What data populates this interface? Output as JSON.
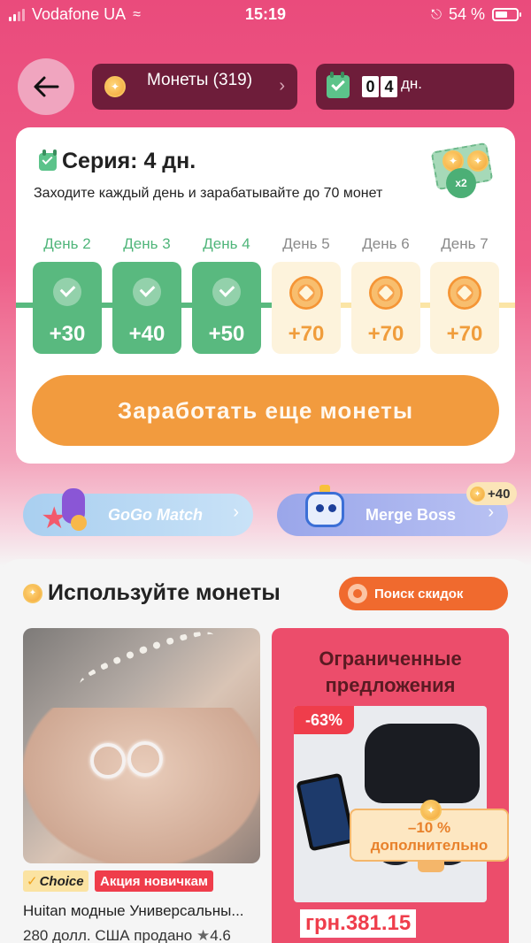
{
  "status_bar": {
    "carrier": "Vodafone UA",
    "time": "15:19",
    "battery": "54 %"
  },
  "header": {
    "coins_label": "Монеты (319)",
    "days_digits": [
      "0",
      "4"
    ],
    "days_unit": "дн."
  },
  "streak": {
    "title": "Серия: 4 дн.",
    "subtitle": "Заходите каждый день и зарабатывайте до 70 монет",
    "badge_text": "x2",
    "days": [
      {
        "label": "День 2",
        "amount": "+30",
        "claimed": true
      },
      {
        "label": "День 3",
        "amount": "+40",
        "claimed": true
      },
      {
        "label": "День 4",
        "amount": "+50",
        "claimed": true
      },
      {
        "label": "День 5",
        "amount": "+70",
        "claimed": false
      },
      {
        "label": "День 6",
        "amount": "+70",
        "claimed": false
      },
      {
        "label": "День 7",
        "amount": "+70",
        "claimed": false
      }
    ],
    "earn_button": "Заработать еще монеты"
  },
  "games": {
    "gogo_match": "GoGo Match",
    "merge_boss": "Merge Boss",
    "merge_bonus": "+40"
  },
  "use_coins": {
    "title": "Используйте монеты",
    "discount_button": "Поиск скидок",
    "product": {
      "choice_badge": "Choice",
      "promo_badge": "Акция новичкам",
      "name": "Huitan модные Универсальны...",
      "sold": "280 долл. США продано",
      "rating": "4.6"
    },
    "limited": {
      "title_line1": "Ограниченные",
      "title_line2": "предложения",
      "discount": "-63%",
      "extra_line1": "–10 %",
      "extra_line2": "дополнительно",
      "price": "грн.381.15"
    }
  },
  "colors": {
    "primary_pink": "#ea4b7c",
    "dark_pill": "#6e1d3a",
    "claimed_green": "#59b97f",
    "earn_orange": "#f29b3e",
    "sale_red": "#ef3d4b"
  },
  "icons": {
    "back": "arrow-left-icon",
    "coin": "coin-icon",
    "calendar": "calendar-check-icon",
    "check": "check-icon",
    "reward": "coin-flower-icon"
  }
}
